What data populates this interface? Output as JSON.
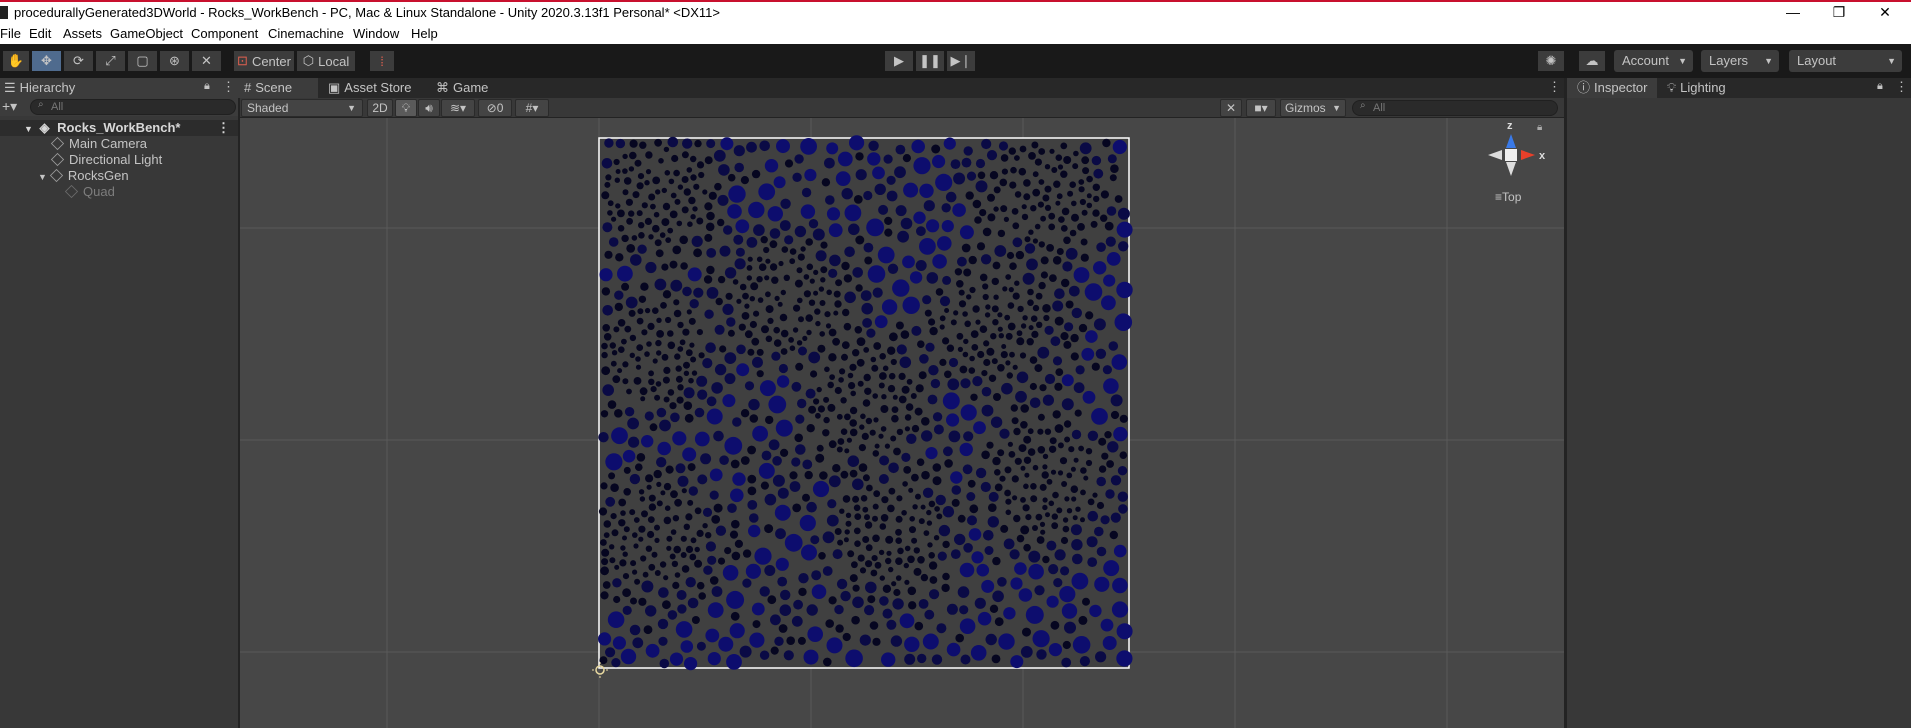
{
  "window": {
    "title": "procedurallyGenerated3DWorld - Rocks_WorkBench - PC, Mac & Linux Standalone - Unity 2020.3.13f1 Personal* <DX11>",
    "minimize": "—",
    "maximize": "❐",
    "close": "✕"
  },
  "menu": [
    "File",
    "Edit",
    "Assets",
    "GameObject",
    "Component",
    "Cinemachine",
    "Window",
    "Help"
  ],
  "toolbar": {
    "pivot_label": "Center",
    "space_label": "Local",
    "account_label": "Account",
    "layers_label": "Layers",
    "layout_label": "Layout"
  },
  "hierarchy": {
    "tab_label": "Hierarchy",
    "search_placeholder": "All",
    "root": "Rocks_WorkBench*",
    "items": [
      {
        "label": "Main Camera"
      },
      {
        "label": "Directional Light"
      },
      {
        "label": "RocksGen"
      },
      {
        "label": "Quad"
      }
    ]
  },
  "scene": {
    "tabs": [
      {
        "label": "Scene"
      },
      {
        "label": "Asset Store"
      },
      {
        "label": "Game"
      }
    ],
    "shading_mode": "Shaded",
    "mode_2d": "2D",
    "hidden_count": "0",
    "gizmos_label": "Gizmos",
    "search_placeholder": "All",
    "view_label": "Top",
    "axis_z": "z",
    "axis_x": "x"
  },
  "inspector": {
    "tabs": [
      {
        "label": "Inspector"
      },
      {
        "label": "Lighting"
      }
    ]
  },
  "colors": {
    "accent_title": "#c8102e",
    "rock_big": "#0d0d6e",
    "rock_small": "#060620",
    "quad_bg": "#404040",
    "selection_outline": "#ffffff"
  }
}
